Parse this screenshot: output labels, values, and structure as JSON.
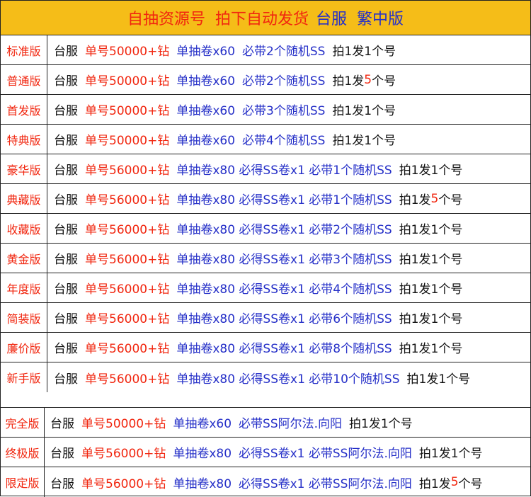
{
  "header": {
    "part1": "自抽资源号  拍下自动发货",
    "part2": "台服  繁中版"
  },
  "rows_top": [
    {
      "label": "标准版",
      "segs": [
        {
          "t": "台服",
          "c": "blk"
        },
        {
          "t": "单号50000+钻",
          "c": "red"
        },
        {
          "t": "单抽卷x60",
          "c": "blue"
        },
        {
          "t": "必带2个随机SS",
          "c": "blue"
        },
        {
          "t": "拍1发1个号",
          "c": "blk"
        }
      ]
    },
    {
      "label": "普通版",
      "segs": [
        {
          "t": "台服",
          "c": "blk"
        },
        {
          "t": "单号50000+钻",
          "c": "red"
        },
        {
          "t": "单抽卷x60",
          "c": "blue"
        },
        {
          "t": "必带2个随机SS",
          "c": "blue"
        },
        {
          "t": "拍1发",
          "c": "blk"
        },
        {
          "t": "5",
          "c": "red",
          "ng": 1
        },
        {
          "t": "个号",
          "c": "blk",
          "ng": 1
        }
      ]
    },
    {
      "label": "首发版",
      "segs": [
        {
          "t": "台服",
          "c": "blk"
        },
        {
          "t": "单号50000+钻",
          "c": "red"
        },
        {
          "t": "单抽卷x60",
          "c": "blue"
        },
        {
          "t": "必带3个随机SS",
          "c": "blue"
        },
        {
          "t": "拍1发1个号",
          "c": "blk"
        }
      ]
    },
    {
      "label": "特典版",
      "segs": [
        {
          "t": "台服",
          "c": "blk"
        },
        {
          "t": "单号50000+钻",
          "c": "red"
        },
        {
          "t": "单抽卷x60",
          "c": "blue"
        },
        {
          "t": "必带4个随机SS",
          "c": "blue"
        },
        {
          "t": "拍1发1个号",
          "c": "blk"
        }
      ]
    },
    {
      "label": "豪华版",
      "segs": [
        {
          "t": "台服",
          "c": "blk"
        },
        {
          "t": "单号56000+钻",
          "c": "red"
        },
        {
          "t": "单抽卷x80 必得SS卷x1 必带1个随机SS",
          "c": "blue"
        },
        {
          "t": "拍1发1个号",
          "c": "blk"
        }
      ]
    },
    {
      "label": "典藏版",
      "segs": [
        {
          "t": "台服",
          "c": "blk"
        },
        {
          "t": "单号56000+钻",
          "c": "red"
        },
        {
          "t": "单抽卷x80 必得SS卷x1 必带1个随机SS",
          "c": "blue"
        },
        {
          "t": "拍1发",
          "c": "blk"
        },
        {
          "t": "5",
          "c": "red",
          "ng": 1
        },
        {
          "t": "个号",
          "c": "blk",
          "ng": 1
        }
      ]
    },
    {
      "label": "收藏版",
      "segs": [
        {
          "t": "台服",
          "c": "blk"
        },
        {
          "t": "单号56000+钻",
          "c": "red"
        },
        {
          "t": "单抽卷x80 必得SS卷x1 必带2个随机SS",
          "c": "blue"
        },
        {
          "t": "拍1发1个号",
          "c": "blk"
        }
      ]
    },
    {
      "label": "黄金版",
      "segs": [
        {
          "t": "台服",
          "c": "blk"
        },
        {
          "t": "单号56000+钻",
          "c": "red"
        },
        {
          "t": "单抽卷x80 必得SS卷x1 必带3个随机SS",
          "c": "blue"
        },
        {
          "t": "拍1发1个号",
          "c": "blk"
        }
      ]
    },
    {
      "label": "年度版",
      "segs": [
        {
          "t": "台服",
          "c": "blk"
        },
        {
          "t": "单号56000+钻",
          "c": "red"
        },
        {
          "t": "单抽卷x80 必得SS卷x1 必带4个随机SS",
          "c": "blue"
        },
        {
          "t": "拍1发1个号",
          "c": "blk"
        }
      ]
    },
    {
      "label": "简装版",
      "segs": [
        {
          "t": "台服",
          "c": "blk"
        },
        {
          "t": "单号56000+钻",
          "c": "red"
        },
        {
          "t": "单抽卷x80 必得SS卷x1 必带6个随机SS",
          "c": "blue"
        },
        {
          "t": "拍1发1个号",
          "c": "blk"
        }
      ]
    },
    {
      "label": "廉价版",
      "segs": [
        {
          "t": "台服",
          "c": "blk"
        },
        {
          "t": "单号56000+钻",
          "c": "red"
        },
        {
          "t": "单抽卷x80 必得SS卷x1 必带8个随机SS",
          "c": "blue"
        },
        {
          "t": "拍1发1个号",
          "c": "blk"
        }
      ]
    },
    {
      "label": "新手版",
      "segs": [
        {
          "t": "台服",
          "c": "blk"
        },
        {
          "t": "单号56000+钻",
          "c": "red"
        },
        {
          "t": "单抽卷x80 必得SS卷x1 必带10个随机SS",
          "c": "blue"
        },
        {
          "t": "拍1发1个号",
          "c": "blk"
        }
      ]
    }
  ],
  "rows_bottom": [
    {
      "label": "完全版",
      "segs": [
        {
          "t": "台服",
          "c": "blk"
        },
        {
          "t": "单号50000+钻",
          "c": "red"
        },
        {
          "t": "单抽卷x60",
          "c": "blue"
        },
        {
          "t": "必带SS阿尔法.向阳",
          "c": "blue"
        },
        {
          "t": "拍1发1个号",
          "c": "blk"
        }
      ]
    },
    {
      "label": "终极版",
      "segs": [
        {
          "t": "台服",
          "c": "blk"
        },
        {
          "t": "单号56000+钻",
          "c": "red"
        },
        {
          "t": "单抽卷x80",
          "c": "blue"
        },
        {
          "t": "必得SS卷x1 必带SS阿尔法.向阳",
          "c": "blue"
        },
        {
          "t": "拍1发1个号",
          "c": "blk"
        }
      ]
    },
    {
      "label": "限定版",
      "segs": [
        {
          "t": "台服",
          "c": "blk"
        },
        {
          "t": "单号56000+钻",
          "c": "red"
        },
        {
          "t": "单抽卷x80",
          "c": "blue"
        },
        {
          "t": "必得SS卷x1 必带SS阿尔法.向阳",
          "c": "blue"
        },
        {
          "t": "拍1发",
          "c": "blk"
        },
        {
          "t": "5",
          "c": "red",
          "ng": 1
        },
        {
          "t": "个号",
          "c": "blk",
          "ng": 1
        }
      ]
    }
  ],
  "colors": {
    "header_bg": "#f5bd18",
    "red": "#f1260f",
    "blue": "#2630c8",
    "text": "#111111"
  }
}
